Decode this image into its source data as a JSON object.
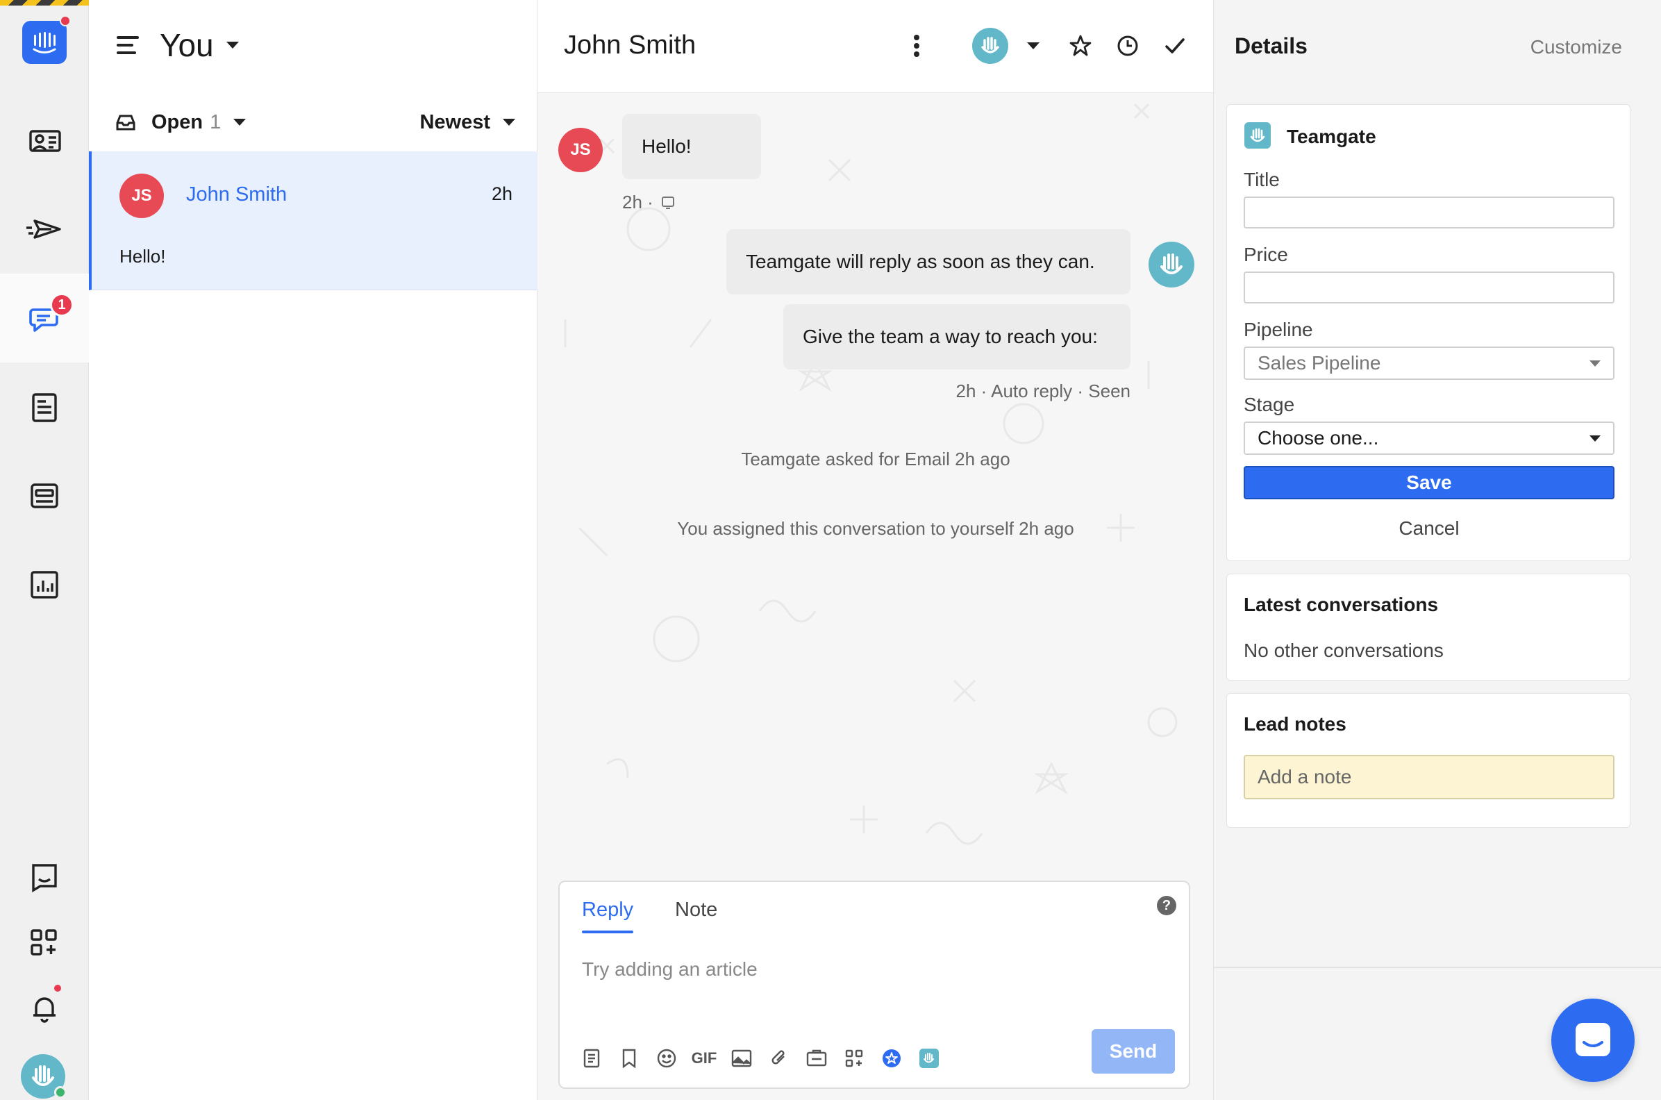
{
  "colors": {
    "accent": "#2d6cf0",
    "badge": "#e8394f",
    "avatar_js": "#e84a55",
    "teamgate": "#62b8c8",
    "note_bg": "#fdf4d3"
  },
  "rail": {
    "logo_icon": "intercom-logo-icon",
    "items": [
      {
        "icon": "contacts-icon"
      },
      {
        "icon": "outbound-icon"
      },
      {
        "icon": "inbox-icon",
        "badge": "1",
        "active": true
      },
      {
        "icon": "articles-icon"
      },
      {
        "icon": "messages-icon"
      },
      {
        "icon": "reports-icon"
      },
      {
        "icon": "messenger-icon"
      },
      {
        "icon": "apps-icon"
      },
      {
        "icon": "notifications-icon"
      },
      {
        "icon": "user-avatar-icon"
      }
    ]
  },
  "inbox": {
    "title": "You",
    "filter_label": "Open",
    "filter_count": "1",
    "sort_label": "Newest",
    "conversations": [
      {
        "initials": "JS",
        "name": "John Smith",
        "time": "2h",
        "snippet": "Hello!"
      }
    ]
  },
  "conversation": {
    "title": "John Smith",
    "header_icons": [
      "more-icon",
      "teamgate-assignee-icon",
      "chevron-down-icon",
      "star-icon",
      "snooze-icon",
      "check-icon"
    ],
    "messages": [
      {
        "from": "JS",
        "text": "Hello!",
        "meta": "2h ·"
      },
      {
        "from": "bot",
        "text": "Teamgate will reply as soon as they can."
      },
      {
        "from": "bot",
        "text": "Give the team a way to reach you:",
        "meta": "2h · Auto reply · Seen"
      }
    ],
    "events": [
      "Teamgate asked for Email 2h ago",
      "You assigned this conversation to yourself 2h ago"
    ],
    "composer": {
      "tab_reply": "Reply",
      "tab_note": "Note",
      "help": "?",
      "placeholder": "Try adding an article",
      "gif_label": "GIF",
      "send": "Send"
    }
  },
  "details": {
    "title": "Details",
    "customize": "Customize",
    "teamgate": {
      "title": "Teamgate",
      "title_label": "Title",
      "price_label": "Price",
      "pipeline_label": "Pipeline",
      "pipeline_value": "Sales Pipeline",
      "stage_label": "Stage",
      "stage_value": "Choose one...",
      "save": "Save",
      "cancel": "Cancel"
    },
    "latest": {
      "title": "Latest conversations",
      "empty": "No other conversations"
    },
    "notes": {
      "title": "Lead notes",
      "placeholder": "Add a note"
    }
  }
}
